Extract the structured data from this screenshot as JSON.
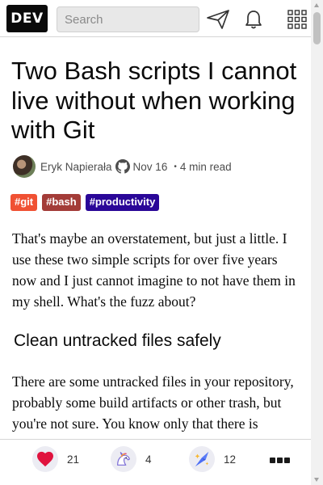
{
  "header": {
    "logo_text": "DEV",
    "search_placeholder": "Search",
    "icons": [
      "send-icon",
      "bell-icon",
      "grid-menu-icon"
    ]
  },
  "article": {
    "title": "Two Bash scripts I cannot live without when working with Git",
    "author": "Eryk Napierała",
    "date": "Nov 16",
    "separator": "•",
    "read_time": "4 min read",
    "tags": [
      {
        "label": "#git",
        "color": "#f05133"
      },
      {
        "label": "#bash",
        "color": "#a33c38"
      },
      {
        "label": "#productivity",
        "color": "#2a0798"
      }
    ],
    "intro": "That's maybe an overstatement, but just a little. I use these two simple scripts for over five years now and I just cannot imagine to not have them in my shell. What's the fuzz about?",
    "heading": "Clean untracked files safely",
    "paragraph2": "There are some untracked files in your repository, probably some build artifacts or other trash, but you're not sure. You know only that there is"
  },
  "reactions": {
    "heart": {
      "count": "21",
      "icon": "heart-icon"
    },
    "unicorn": {
      "count": "4",
      "icon": "unicorn-icon"
    },
    "bookmark": {
      "count": "12",
      "icon": "bookmark-icon"
    },
    "more": {
      "icon": "more-options-icon"
    }
  },
  "colors": {
    "heart": "#e0133e",
    "bookmark_blue": "#4c6ef5",
    "reaction_bg": "#ececf3"
  }
}
